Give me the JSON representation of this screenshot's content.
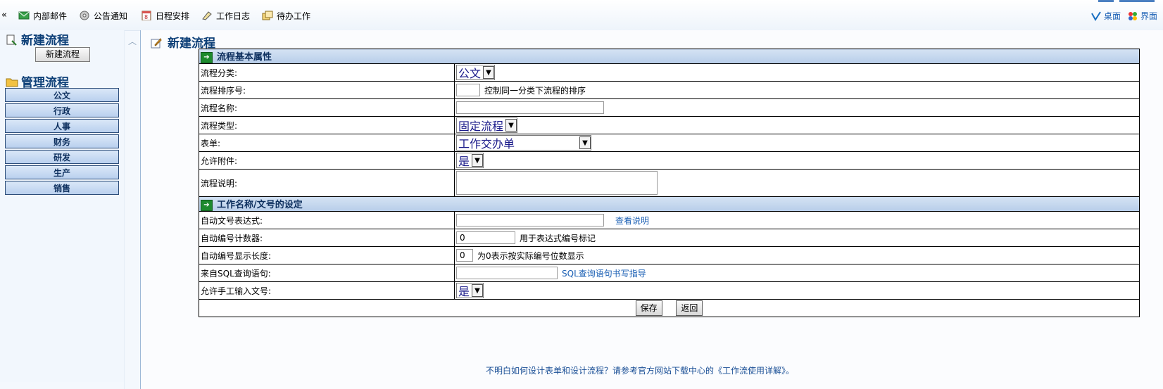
{
  "topbar": {
    "collapse_glyph": "«",
    "items": [
      {
        "label": "内部邮件",
        "icon": "mail-icon"
      },
      {
        "label": "公告通知",
        "icon": "announce-icon"
      },
      {
        "label": "日程安排",
        "icon": "calendar-icon"
      },
      {
        "label": "工作日志",
        "icon": "log-icon"
      },
      {
        "label": "待办工作",
        "icon": "todo-icon"
      }
    ],
    "right": [
      {
        "label": "桌面",
        "icon": "desktop-icon"
      },
      {
        "label": "界面",
        "icon": "theme-icon"
      }
    ]
  },
  "sidebar": {
    "new_flow_title": "新建流程",
    "new_flow_button": "新建流程",
    "manage_title": "管理流程",
    "categories": [
      "公文",
      "行政",
      "人事",
      "财务",
      "研发",
      "生产",
      "销售"
    ]
  },
  "main": {
    "title": "新建流程",
    "section1": "流程基本属性",
    "section2": "工作名称/文号的设定",
    "fields": {
      "category_label": "流程分类:",
      "category_value": "公文",
      "order_label": "流程排序号:",
      "order_hint": "控制同一分类下流程的排序",
      "name_label": "流程名称:",
      "type_label": "流程类型:",
      "type_value": "固定流程",
      "form_label": "表单:",
      "form_value": "工作交办单",
      "attach_label": "允许附件:",
      "attach_value": "是",
      "desc_label": "流程说明:",
      "expr_label": "自动文号表达式:",
      "expr_link": "查看说明",
      "counter_label": "自动编号计数器:",
      "counter_value": "0",
      "counter_hint": "用于表达式编号标记",
      "length_label": "自动编号显示长度:",
      "length_value": "0",
      "length_hint": "为0表示按实际编号位数显示",
      "sql_label": "来自SQL查询语句:",
      "sql_link": "SQL查询语句书写指导",
      "manual_label": "允许手工输入文号:",
      "manual_value": "是"
    },
    "save_button": "保存",
    "back_button": "返回",
    "footer": "不明白如何设计表单和设计流程？请参考官方网站下载中心的《工作流使用详解》。"
  }
}
